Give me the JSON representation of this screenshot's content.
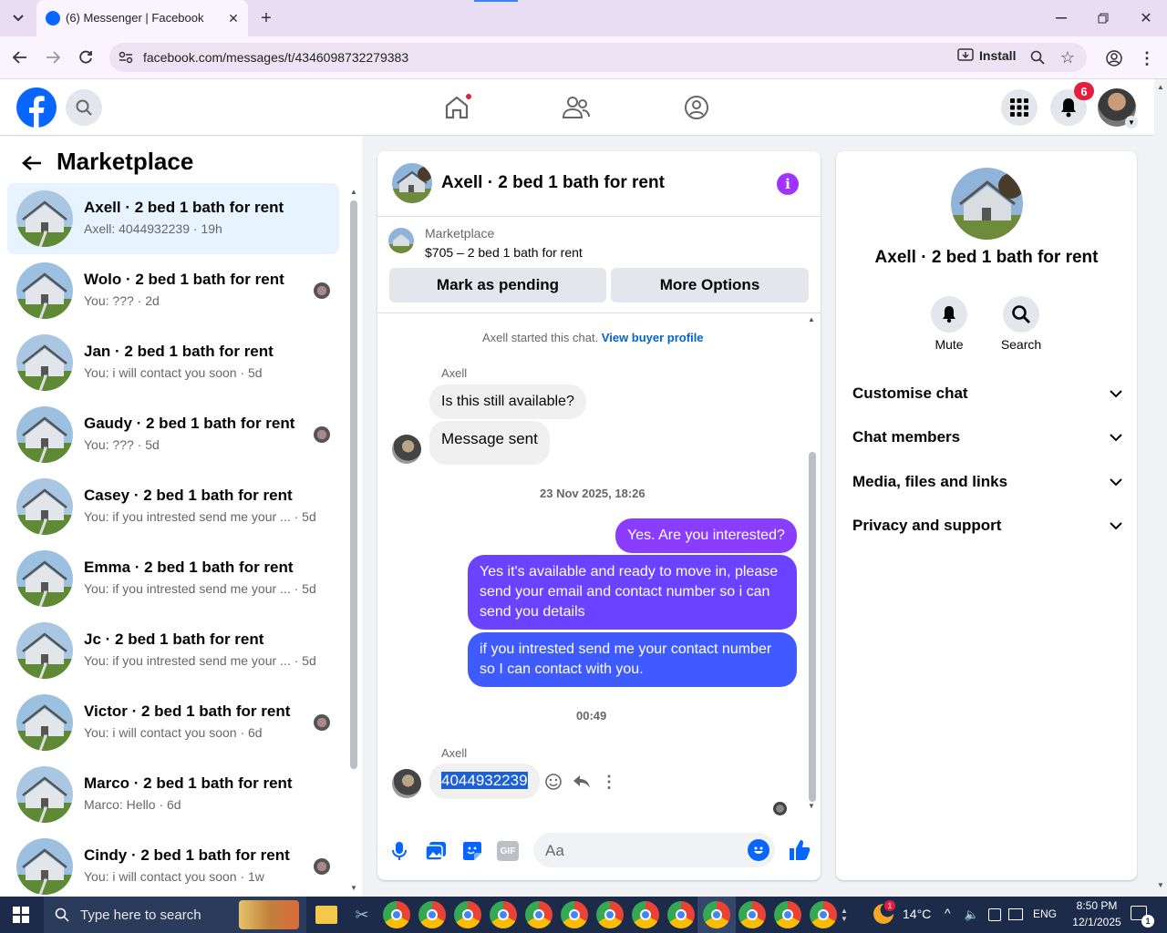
{
  "browser": {
    "tab_title": "(6) Messenger | Facebook",
    "url": "facebook.com/messages/t/4346098732279383",
    "install_label": "Install"
  },
  "fb": {
    "notifications_count": "6",
    "accent": "#0866ff"
  },
  "left_panel": {
    "title": "Marketplace",
    "conversations": [
      {
        "name": "Axell · 2 bed 1 bath for rent",
        "preview": "Axell: 4044932239 · 19h",
        "active": true
      },
      {
        "name": "Wolo · 2 bed 1 bath for rent",
        "preview": "You: ??? · 2d"
      },
      {
        "name": "Jan · 2 bed 1 bath for rent",
        "preview": "You: i will contact you soon · 5d"
      },
      {
        "name": "Gaudy · 2 bed 1 bath for rent",
        "preview": "You: ??? · 5d"
      },
      {
        "name": "Casey · 2 bed 1 bath for rent",
        "preview": "You: if you intrested send me your ... · 5d"
      },
      {
        "name": "Emma · 2 bed 1 bath for rent",
        "preview": "You: if you intrested send me your ... · 5d"
      },
      {
        "name": "Jc · 2 bed 1 bath for rent",
        "preview": "You: if you intrested send me your ... · 5d"
      },
      {
        "name": "Victor · 2 bed 1 bath for rent",
        "preview": "You: i will contact you soon · 6d"
      },
      {
        "name": "Marco · 2 bed 1 bath for rent",
        "preview": "Marco: Hello · 6d"
      },
      {
        "name": "Cindy · 2 bed 1 bath for rent",
        "preview": "You: i will contact you soon · 1w"
      }
    ]
  },
  "chat": {
    "title": "Axell · 2 bed 1 bath for rent",
    "listing_source": "Marketplace",
    "listing_desc": "$705 – 2 bed 1 bath for rent",
    "mark_pending": "Mark as pending",
    "more_options": "More Options",
    "started_text": "Axell started this chat.",
    "buyer_profile_link": "View buyer profile",
    "sender_name": "Axell",
    "msg1": "Is this still available?",
    "msg2": "Message sent",
    "timestamp1": "23 Nov 2025, 18:26",
    "out1": "Yes. Are you interested?",
    "out2": "Yes it's available and ready to move in, please send your email and contact number so i can send you details",
    "out3": "if you intrested send me your contact number so I can contact with you.",
    "timestamp2": "00:49",
    "sender_name2": "Axell",
    "msg3": "4044932239",
    "composer_placeholder": "Aa"
  },
  "info_panel": {
    "title": "Axell · 2 bed 1 bath for rent",
    "mute_label": "Mute",
    "search_label": "Search",
    "sections": [
      "Customise chat",
      "Chat members",
      "Media, files and links",
      "Privacy and support"
    ]
  },
  "taskbar": {
    "search_placeholder": "Type here to search",
    "temperature": "14°C",
    "language": "ENG",
    "time": "8:50 PM",
    "date": "12/1/2025",
    "notif_count": "1"
  }
}
